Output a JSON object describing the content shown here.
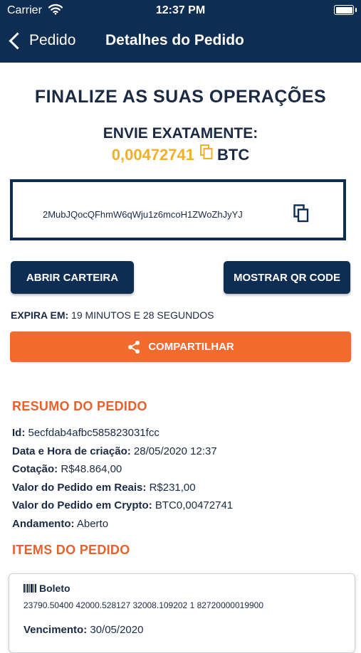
{
  "status_bar": {
    "carrier": "Carrier",
    "time": "12:37 PM"
  },
  "nav": {
    "back_label": "Pedido",
    "title": "Detalhes do Pedido"
  },
  "main": {
    "title": "FINALIZE AS SUAS OPERAÇÕES",
    "send_label": "ENVIE EXATAMENTE:",
    "amount": "0,00472741",
    "currency": "BTC",
    "address": "2MubJQocQFhmW6qWju1z6mcoH1ZWoZhJyYJ",
    "open_wallet_label": "ABRIR CARTEIRA",
    "show_qr_label": "MOSTRAR QR CODE",
    "expires_key": "EXPIRA EM:",
    "expires_value": "19 MINUTOS E 28 SEGUNDOS",
    "share_label": "COMPARTILHAR"
  },
  "summary": {
    "heading": "RESUMO DO PEDIDO",
    "rows": [
      {
        "key": "Id:",
        "value": "5ecfdab4afbc585823031fcc"
      },
      {
        "key": "Data e Hora de criação:",
        "value": "28/05/2020 12:37"
      },
      {
        "key": "Cotação:",
        "value": "R$48.864,00"
      },
      {
        "key": "Valor do Pedido em Reais:",
        "value": "R$231,00"
      },
      {
        "key": "Valor do Pedido em Crypto:",
        "value": "BTC0,00472741"
      },
      {
        "key": "Andamento:",
        "value": "Aberto"
      }
    ]
  },
  "items": {
    "heading": "ITEMS DO PEDIDO",
    "list": [
      {
        "name": "Boleto",
        "code": "23790.50400 42000.528127 32008.109202 1 82720000019900",
        "due_key": "Vencimento:",
        "due_value": "30/05/2020"
      }
    ]
  },
  "colors": {
    "navy": "#0e2d52",
    "orange": "#f26a2e",
    "gold": "#f0b02a",
    "section_orange": "#e8612a"
  },
  "icons": [
    "wifi-icon",
    "battery-icon",
    "back-chevron-icon",
    "copy-icon",
    "share-icon",
    "barcode-icon"
  ]
}
